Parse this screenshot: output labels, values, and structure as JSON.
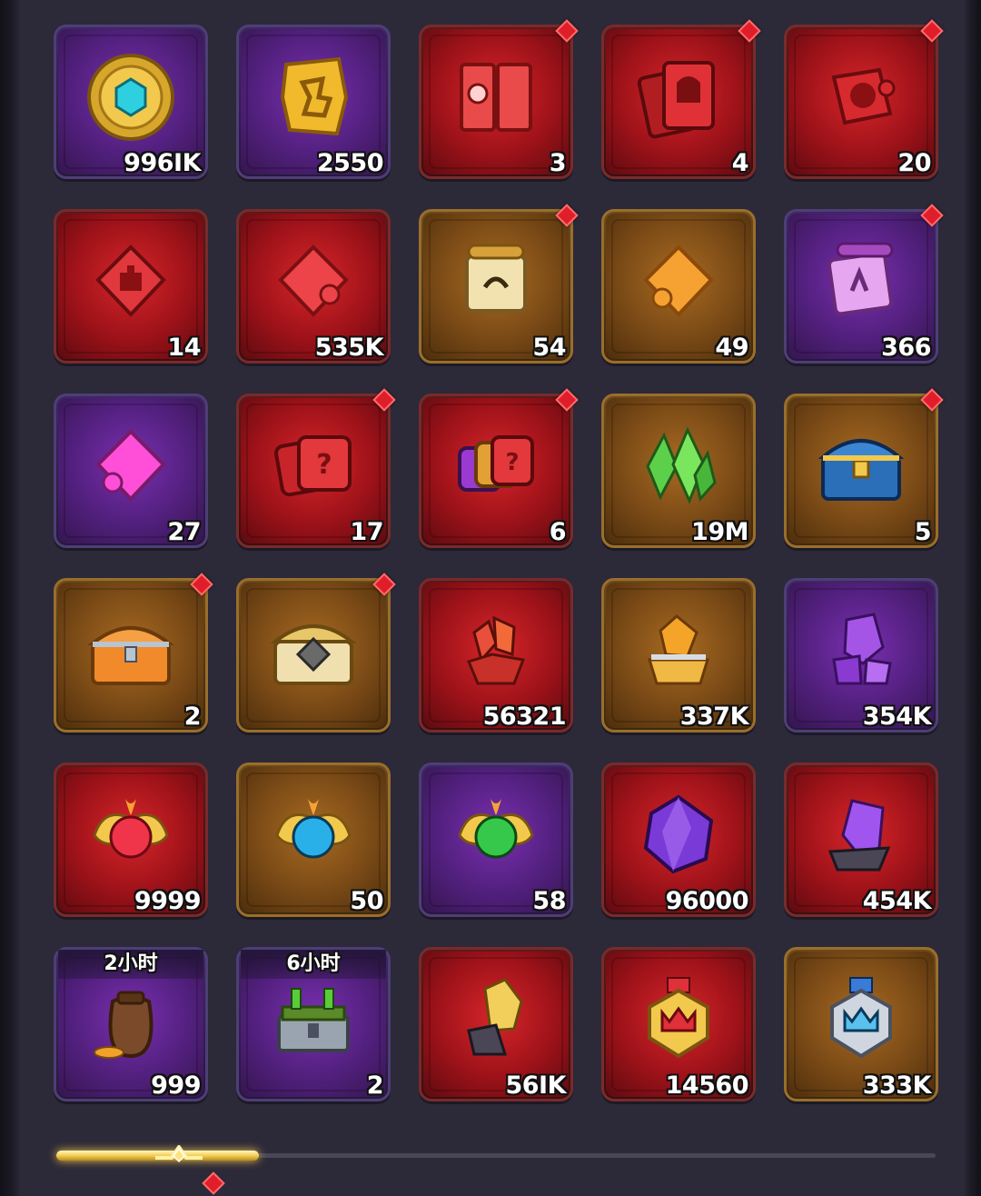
{
  "inventory": {
    "items": [
      {
        "name": "hex-gem-coin",
        "count": "996IK",
        "rarity": "purple",
        "badge": false,
        "timer": ""
      },
      {
        "name": "gold-rune-stone",
        "count": "2550",
        "rarity": "purple",
        "badge": false,
        "timer": ""
      },
      {
        "name": "red-card-book",
        "count": "3",
        "rarity": "red",
        "badge": true,
        "timer": ""
      },
      {
        "name": "spartan-card-pack",
        "count": "4",
        "rarity": "red",
        "badge": true,
        "timer": ""
      },
      {
        "name": "spartan-puzzle-pieces",
        "count": "20",
        "rarity": "red",
        "badge": true,
        "timer": ""
      },
      {
        "name": "red-castle-puzzle",
        "count": "14",
        "rarity": "red",
        "badge": false,
        "timer": ""
      },
      {
        "name": "red-puzzle-piece",
        "count": "535K",
        "rarity": "red",
        "badge": false,
        "timer": ""
      },
      {
        "name": "ancient-scroll",
        "count": "54",
        "rarity": "gold",
        "badge": true,
        "timer": ""
      },
      {
        "name": "orange-puzzle-piece",
        "count": "49",
        "rarity": "gold",
        "badge": false,
        "timer": ""
      },
      {
        "name": "purple-scroll",
        "count": "366",
        "rarity": "purple",
        "badge": true,
        "timer": ""
      },
      {
        "name": "magenta-puzzle-piece",
        "count": "27",
        "rarity": "purple",
        "badge": false,
        "timer": ""
      },
      {
        "name": "red-mystery-puzzle",
        "count": "17",
        "rarity": "red",
        "badge": true,
        "timer": ""
      },
      {
        "name": "mixed-mystery-puzzle",
        "count": "6",
        "rarity": "red",
        "badge": true,
        "timer": ""
      },
      {
        "name": "green-crystal",
        "count": "19M",
        "rarity": "gold",
        "badge": false,
        "timer": ""
      },
      {
        "name": "blue-chest",
        "count": "5",
        "rarity": "gold",
        "badge": true,
        "timer": ""
      },
      {
        "name": "orange-iron-chest",
        "count": "2",
        "rarity": "gold",
        "badge": true,
        "timer": ""
      },
      {
        "name": "gold-rune-chest",
        "count": "",
        "rarity": "gold",
        "badge": true,
        "timer": ""
      },
      {
        "name": "red-ore-crystal",
        "count": "56321",
        "rarity": "red",
        "badge": false,
        "timer": ""
      },
      {
        "name": "amber-ore-crystal",
        "count": "337K",
        "rarity": "gold",
        "badge": false,
        "timer": ""
      },
      {
        "name": "purple-ore-crystal",
        "count": "354K",
        "rarity": "purple",
        "badge": false,
        "timer": ""
      },
      {
        "name": "red-heart-potion",
        "count": "9999",
        "rarity": "red",
        "badge": false,
        "timer": ""
      },
      {
        "name": "blue-heart-potion",
        "count": "50",
        "rarity": "gold",
        "badge": false,
        "timer": ""
      },
      {
        "name": "green-heart-potion",
        "count": "58",
        "rarity": "purple",
        "badge": false,
        "timer": ""
      },
      {
        "name": "purple-gem",
        "count": "96000",
        "rarity": "red",
        "badge": false,
        "timer": ""
      },
      {
        "name": "purple-crystal-rock",
        "count": "454K",
        "rarity": "red",
        "badge": false,
        "timer": ""
      },
      {
        "name": "coin-bag",
        "count": "999",
        "rarity": "purple",
        "badge": false,
        "timer": "2小时"
      },
      {
        "name": "potion-crate",
        "count": "2",
        "rarity": "purple",
        "badge": false,
        "timer": "6小时"
      },
      {
        "name": "gold-crystal-rock",
        "count": "56IK",
        "rarity": "red",
        "badge": false,
        "timer": ""
      },
      {
        "name": "gold-crown-medal",
        "count": "14560",
        "rarity": "red",
        "badge": false,
        "timer": ""
      },
      {
        "name": "silver-crown-medal",
        "count": "333K",
        "rarity": "gold",
        "badge": false,
        "timer": ""
      }
    ]
  },
  "scroll": {
    "progress": 0.23
  },
  "colors": {
    "accent": "#f4cf56",
    "badge": "#e01e2a"
  }
}
